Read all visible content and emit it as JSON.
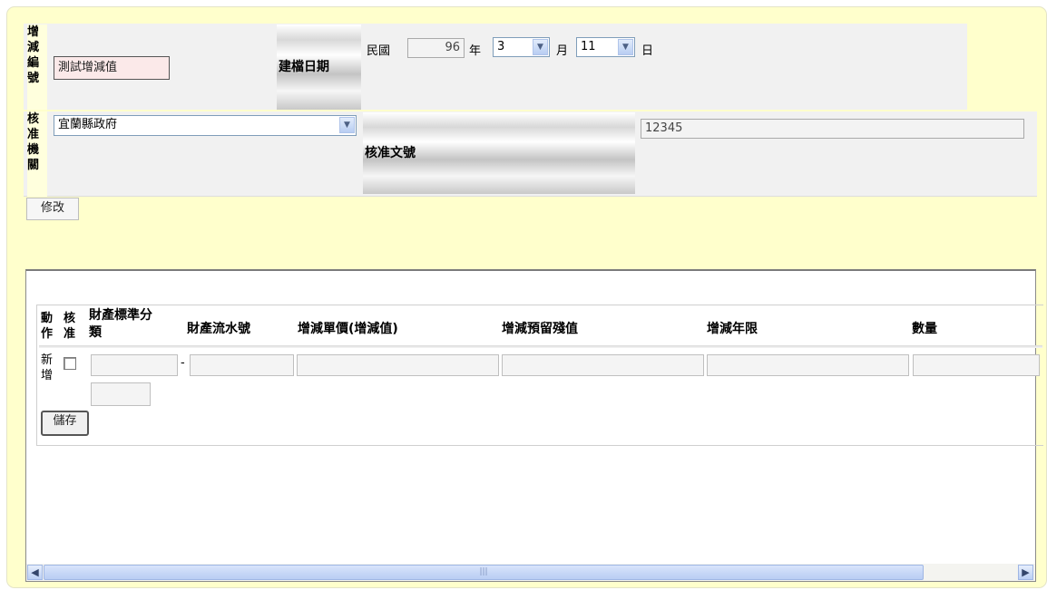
{
  "form": {
    "change_no_label_chars": [
      "增",
      "減",
      "編",
      "號"
    ],
    "change_no_value": "測試增減值",
    "build_date_label": "建檔日期",
    "date_prefix": "民國",
    "year_value": "96",
    "year_unit": "年",
    "month_value": "3",
    "month_unit": "月",
    "day_value": "11",
    "day_unit": "日",
    "approval_org_label_chars": [
      "核",
      "准",
      "機",
      "關"
    ],
    "approval_org_value": "宜蘭縣政府",
    "approval_doc_label": "核准文號",
    "approval_doc_value": "12345",
    "modify_button": "修改"
  },
  "table": {
    "headers": [
      {
        "id": "action",
        "text": "動\n作"
      },
      {
        "id": "approve",
        "text": "核\n准"
      },
      {
        "id": "category",
        "text": "財產標準分\n類"
      },
      {
        "id": "serial",
        "text": "財產流水號"
      },
      {
        "id": "unit_price",
        "text": "增減單價(增減值)"
      },
      {
        "id": "residual",
        "text": "增減預留殘值"
      },
      {
        "id": "years",
        "text": "增減年限"
      },
      {
        "id": "quantity",
        "text": "數量"
      }
    ],
    "new_row_label": "新\n增",
    "category_dash": "-",
    "save_button": "儲存"
  },
  "colors": {
    "panel_bg": "#ffffcc",
    "scroll_thumb": "#c6d6f7"
  }
}
